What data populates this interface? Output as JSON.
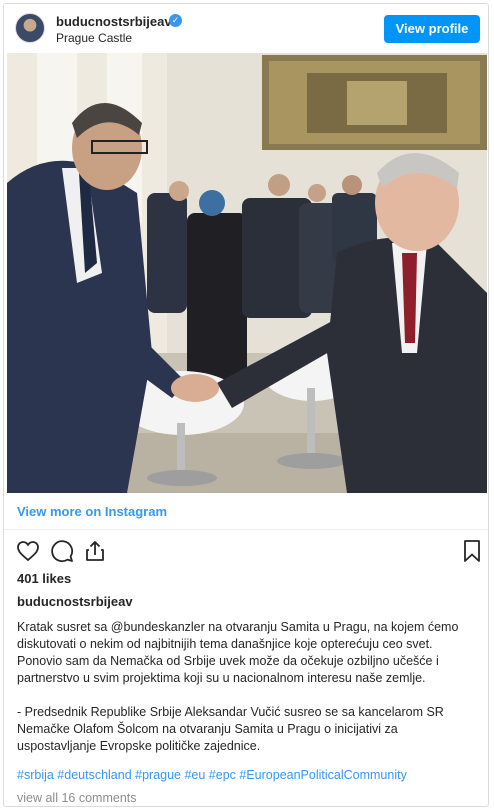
{
  "header": {
    "username": "buducnostsrbijeav",
    "location": "Prague Castle",
    "view_profile_label": "View profile"
  },
  "photo": {
    "alt_description": ""
  },
  "view_more_label": "View more on Instagram",
  "actions": {
    "icons": [
      "heart-icon",
      "comment-icon",
      "share-icon",
      "bookmark-icon"
    ]
  },
  "likes_text": "401 likes",
  "post_username": "buducnostsrbijeav",
  "caption": {
    "p1_mention": "@bundeskanzler",
    "p1_before": "Kratak susret sa ",
    "p1_after": " na otvaranju Samita u Pragu, na kojem ćemo diskutovati o nekim od najbitnijih tema današnjice koje opterećuju ceo svet. Ponovio sam da Nemačka od Srbije uvek može da očekuje ozbiljno učešće i partnerstvo u svim projektima koji su u nacionalnom interesu naše zemlje.",
    "p2": "- Predsednik Republike Srbije Aleksandar Vučić susreo se sa kancelarom SR Nemačke Olafom Šolcom na otvaranju Samita u Pragu o inicijativi za uspostavljanje Evropske političke zajednice."
  },
  "hashtags": "#srbija #deutschland #prague #eu #epc #EuropeanPoliticalCommunity",
  "comments_link": "view all 16 comments",
  "colors": {
    "accent": "#0095f6",
    "link": "#3897f0",
    "muted": "#8e8e8e"
  }
}
